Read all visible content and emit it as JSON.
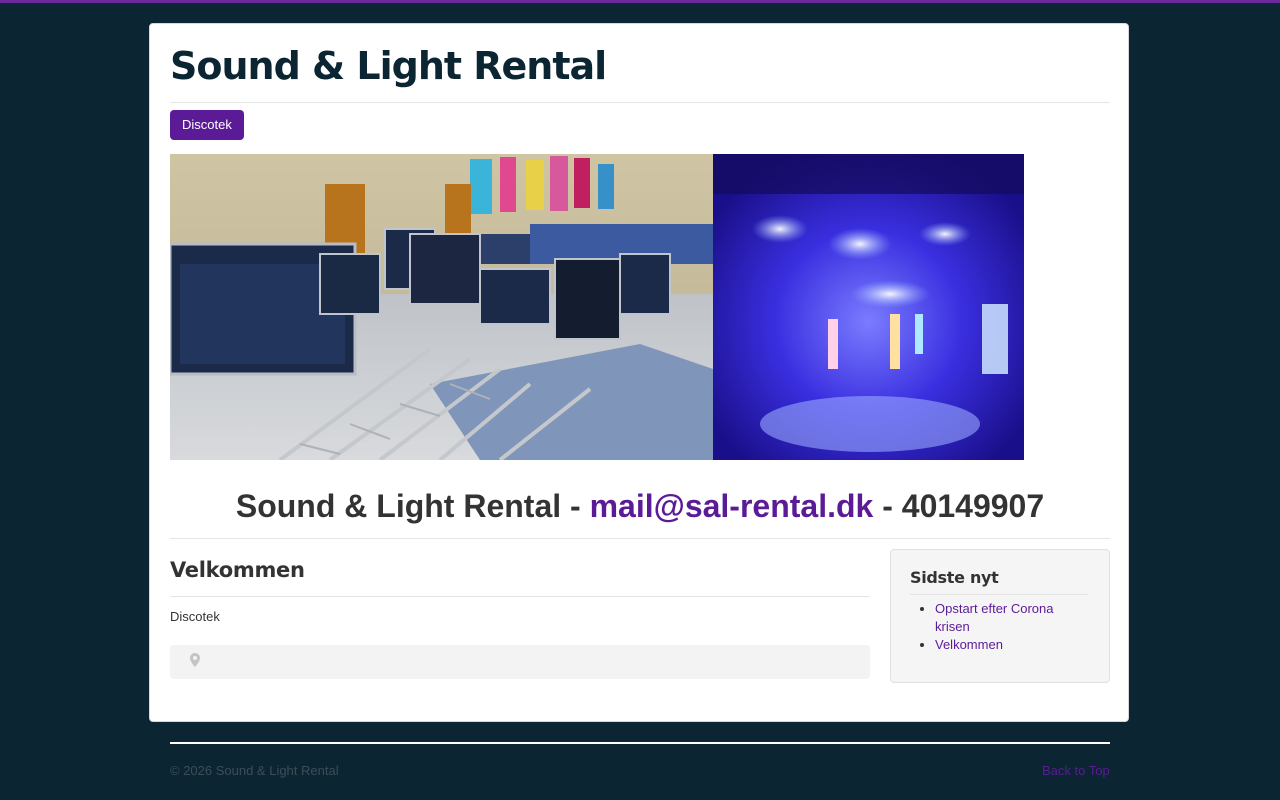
{
  "site": {
    "title": "Sound & Light Rental"
  },
  "nav": {
    "items": [
      {
        "label": "Discotek"
      }
    ]
  },
  "banner": {
    "images": [
      "equipment-cases-in-hall",
      "stage-lights-blue"
    ]
  },
  "contact": {
    "prefix": "Sound & Light Rental - ",
    "email": "mail@sal-rental.dk",
    "separator": " - ",
    "phone": "40149907"
  },
  "main": {
    "heading": "Velkommen",
    "text": "Discotek",
    "location_icon": "map-pin-icon"
  },
  "sidebar": {
    "heading": "Sidste nyt",
    "items": [
      {
        "label": "Opstart efter Corona krisen"
      },
      {
        "label": "Velkommen"
      }
    ]
  },
  "footer": {
    "copyright": "© 2026 Sound & Light Rental",
    "back_to_top": "Back to Top"
  },
  "colors": {
    "background": "#0b2533",
    "accent": "#5b1b96",
    "top_strip": "#6b2a9c"
  }
}
